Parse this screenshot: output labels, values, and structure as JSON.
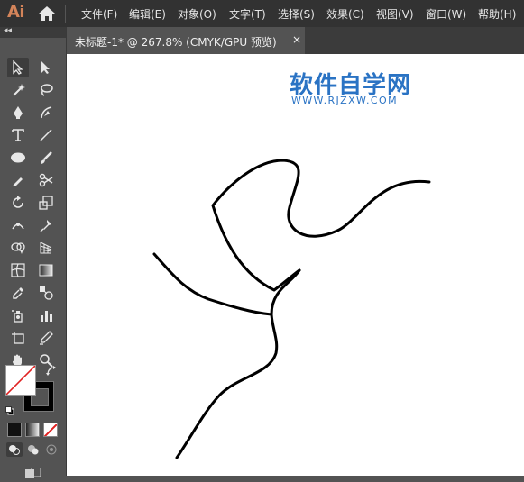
{
  "app": {
    "logo": "Ai"
  },
  "menu": [
    {
      "label": "文件(F)"
    },
    {
      "label": "编辑(E)"
    },
    {
      "label": "对象(O)"
    },
    {
      "label": "文字(T)"
    },
    {
      "label": "选择(S)"
    },
    {
      "label": "效果(C)"
    },
    {
      "label": "视图(V)"
    },
    {
      "label": "窗口(W)"
    },
    {
      "label": "帮助(H)"
    }
  ],
  "toolbar": {
    "collapse_label": "◂◂"
  },
  "tab": {
    "title": "未标题-1* @ 267.8% (CMYK/GPU 预览)",
    "close": "×"
  },
  "watermark": {
    "title": "软件自学网",
    "url": "WWW.RJZXW.COM"
  },
  "colors": {
    "accent": "#2a73c4",
    "logo": "#d4845a",
    "swap_red": "#e02020"
  }
}
